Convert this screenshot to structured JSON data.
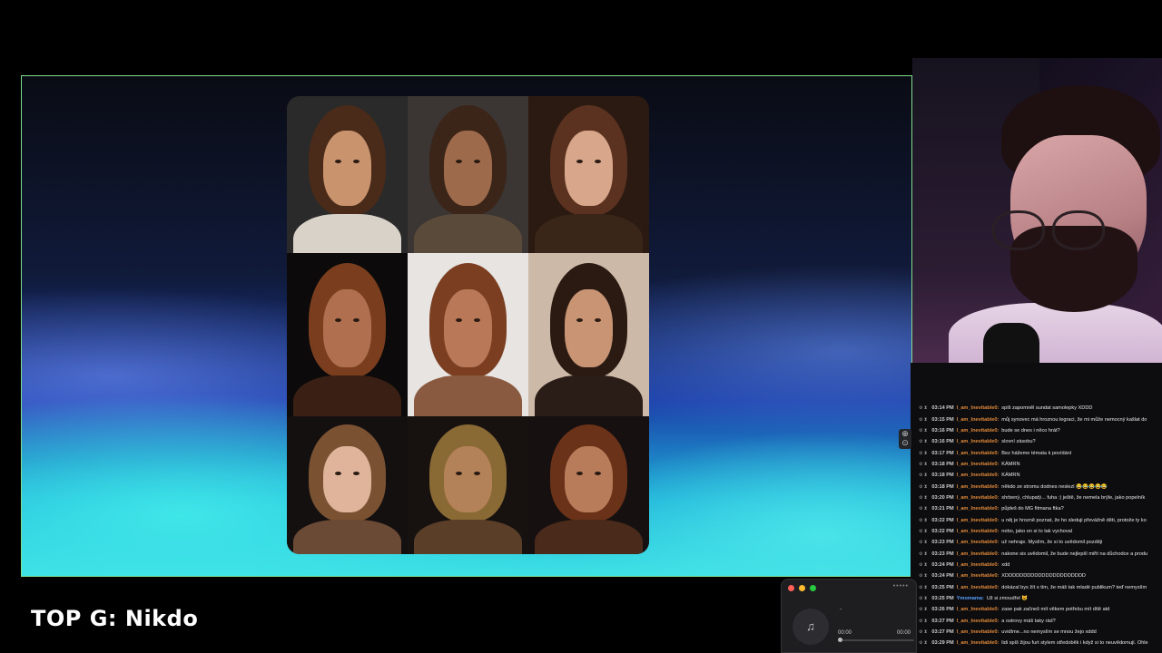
{
  "caption": {
    "text": "TOP G: Nikdo"
  },
  "shared_screen": {
    "portraits": [
      {
        "name": "portrait-young-woman-fur",
        "bg": "#2a2a2a",
        "hair": "#4a2a18",
        "face": "#c9936e",
        "body": "#d8d2c8"
      },
      {
        "name": "portrait-bearded-man-dark",
        "bg": "#3b3533",
        "hair": "#3a2518",
        "face": "#9e6a4c",
        "body": "#5a4a3a"
      },
      {
        "name": "portrait-woman-curly",
        "bg": "#2b1a12",
        "hair": "#5b3220",
        "face": "#d8a68a",
        "body": "#3a2618"
      },
      {
        "name": "portrait-profile-red-hair",
        "bg": "#0c0a0a",
        "hair": "#7a3e1e",
        "face": "#b07050",
        "body": "#3a2014"
      },
      {
        "name": "portrait-man-wild-hair",
        "bg": "#e7e4e2",
        "hair": "#7b3e20",
        "face": "#b97858",
        "body": "#8a5a40"
      },
      {
        "name": "portrait-man-topknot",
        "bg": "#cdb9a8",
        "hair": "#2a1a12",
        "face": "#c89474",
        "body": "#2a1c16"
      },
      {
        "name": "portrait-child",
        "bg": "#151010",
        "hair": "#7a5232",
        "face": "#e0b49a",
        "body": "#6a4a34"
      },
      {
        "name": "portrait-blond-man",
        "bg": "#171210",
        "hair": "#8a6a34",
        "face": "#b48258",
        "body": "#5a3e28"
      },
      {
        "name": "portrait-woman-auburn",
        "bg": "#161010",
        "hair": "#6a3218",
        "face": "#b87c5a",
        "body": "#4a2a1a"
      }
    ]
  },
  "chat": {
    "messages": [
      {
        "time": "03:14 PM",
        "user": "I_am_Inevitable0:",
        "text": "spíš zapomněl sundat samolepky XDDD"
      },
      {
        "time": "03:15 PM",
        "user": "I_am_Inevitable0:",
        "text": "můj synovec má hroznou legraci, že mi může nemocný kašlat do"
      },
      {
        "time": "03:16 PM",
        "user": "I_am_Inevitable0:",
        "text": "bude se dnes i něco hrát?"
      },
      {
        "time": "03:16 PM",
        "user": "I_am_Inevitable0:",
        "text": "slovní zásobu?"
      },
      {
        "time": "03:17 PM",
        "user": "I_am_Inevitable0:",
        "text": "Bez hážeme témata k povídání"
      },
      {
        "time": "03:18 PM",
        "user": "I_am_Inevitable0:",
        "text": "KÁMRN"
      },
      {
        "time": "03:18 PM",
        "user": "I_am_Inevitable0:",
        "text": "KÁMRN"
      },
      {
        "time": "03:18 PM",
        "user": "I_am_Inevitable0:",
        "text": "někdo ze stromu dodnes neslezl 😂😂😂😂😂"
      },
      {
        "time": "03:20 PM",
        "user": "I_am_Inevitable0:",
        "text": "shrbený, chlupatý... fuha :) ještě, že nemela brýle, jako popelník"
      },
      {
        "time": "03:21 PM",
        "user": "I_am_Inevitable0:",
        "text": "půjdeš do MG fitmana ftka?"
      },
      {
        "time": "03:22 PM",
        "user": "I_am_Inevitable0:",
        "text": "u něj je hrozně poznat, že ho sleduji převážně děti, protože ty ko"
      },
      {
        "time": "03:22 PM",
        "user": "I_am_Inevitable0:",
        "text": "nebo, jako on si to tak vychoval"
      },
      {
        "time": "03:23 PM",
        "user": "I_am_Inevitable0:",
        "text": "už nehraje. Myslím, že si to uvědomil později"
      },
      {
        "time": "03:23 PM",
        "user": "I_am_Inevitable0:",
        "text": "nakone sis uvědomil, že bude nejlepší miřit na důchodce a produ"
      },
      {
        "time": "03:24 PM",
        "user": "I_am_Inevitable0:",
        "text": "xdd"
      },
      {
        "time": "03:24 PM",
        "user": "I_am_Inevitable0:",
        "text": "XDDDDDDDDDDDDDDDDDDDDDD"
      },
      {
        "time": "03:25 PM",
        "user": "I_am_Inevitable0:",
        "text": "dokázal bys žít s tím, že máš tak mladé publikum? teď nemyslím"
      },
      {
        "time": "03:25 PM",
        "user": "Ymomama:",
        "text": "Už si zmoudřel 😺",
        "alt": true
      },
      {
        "time": "03:26 PM",
        "user": "I_am_Inevitable0:",
        "text": "zase pak začneš mít věkem potřebu mít dítě atd"
      },
      {
        "time": "03:27 PM",
        "user": "I_am_Inevitable0:",
        "text": "a ostrovy máš taky rád?"
      },
      {
        "time": "03:27 PM",
        "user": "I_am_Inevitable0:",
        "text": "uvidíme...no nemyslím se mnou žejo xddd"
      },
      {
        "time": "03:29 PM",
        "user": "I_am_Inevitable0:",
        "text": "lidi spíš žijou furt stylem středoběk i když si to neuvědomují. Ohle"
      }
    ]
  },
  "player": {
    "title": "-",
    "time_current": "00:00",
    "time_total": "00:00",
    "grip": "•••••",
    "art_icon": "♫",
    "colors": {
      "close": "#ff5f57",
      "minimize": "#febc2e",
      "maximize": "#28c840"
    }
  }
}
